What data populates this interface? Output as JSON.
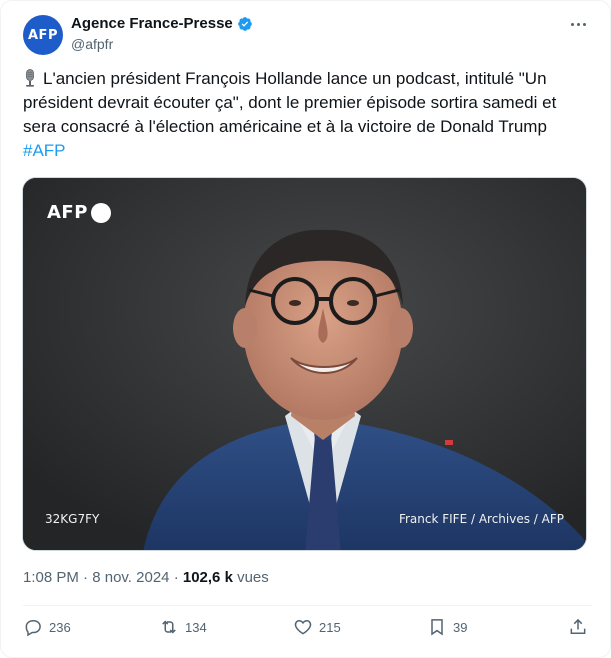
{
  "author": {
    "display_name": "Agence France-Presse",
    "handle": "@afpfr",
    "avatar_text": "AFP",
    "verified": true
  },
  "tweet": {
    "text": "L'ancien président François Hollande lance un podcast, intitulé \"Un président devrait écouter ça\", dont le premier épisode sortira samedi et sera consacré à l'élection américaine et à la victoire de Donald Trump",
    "hashtag": "#AFP",
    "leading_icon": "microphone-icon"
  },
  "media": {
    "logo_text": "AFP",
    "photo_ref": "32KG7FY",
    "credit": "Franck FIFE / Archives / AFP"
  },
  "meta": {
    "time": "1:08 PM",
    "separator": "·",
    "date": "8 nov. 2024",
    "views_count": "102,6 k",
    "views_label": "vues"
  },
  "actions": {
    "reply_count": "236",
    "retweet_count": "134",
    "like_count": "215",
    "bookmark_count": "39"
  },
  "colors": {
    "accent": "#1d9bf0",
    "avatar_bg": "#1d5cc9",
    "secondary_text": "#536471",
    "primary_text": "#0f1419"
  }
}
